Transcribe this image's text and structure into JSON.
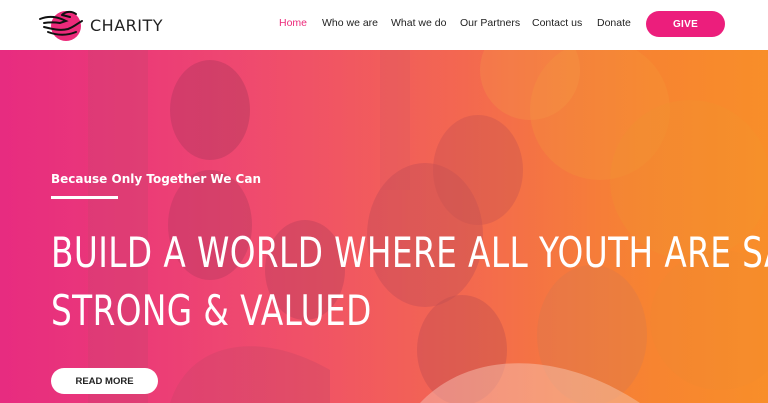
{
  "brand": {
    "name": "CHARITY",
    "logo_icon": "hands-heart-icon"
  },
  "nav": {
    "items": [
      {
        "label": "Home",
        "active": true
      },
      {
        "label": "Who we are",
        "active": false
      },
      {
        "label": "What we do",
        "active": false
      },
      {
        "label": "Our Partners",
        "active": false
      },
      {
        "label": "Contact us",
        "active": false
      },
      {
        "label": "Donate",
        "active": false
      }
    ],
    "give_label": "GIVE"
  },
  "hero": {
    "tagline": "Because Only Together We Can",
    "headline_line1": "BUILD A WORLD WHERE ALL YOUTH ARE SAFE,",
    "headline_line2": "STRONG & VALUED",
    "cta_label": "READ MORE"
  },
  "colors": {
    "accent": "#ec1e7c",
    "gradient_left": "#e6307d",
    "gradient_right": "#f9902a",
    "text_dark": "#222222"
  }
}
